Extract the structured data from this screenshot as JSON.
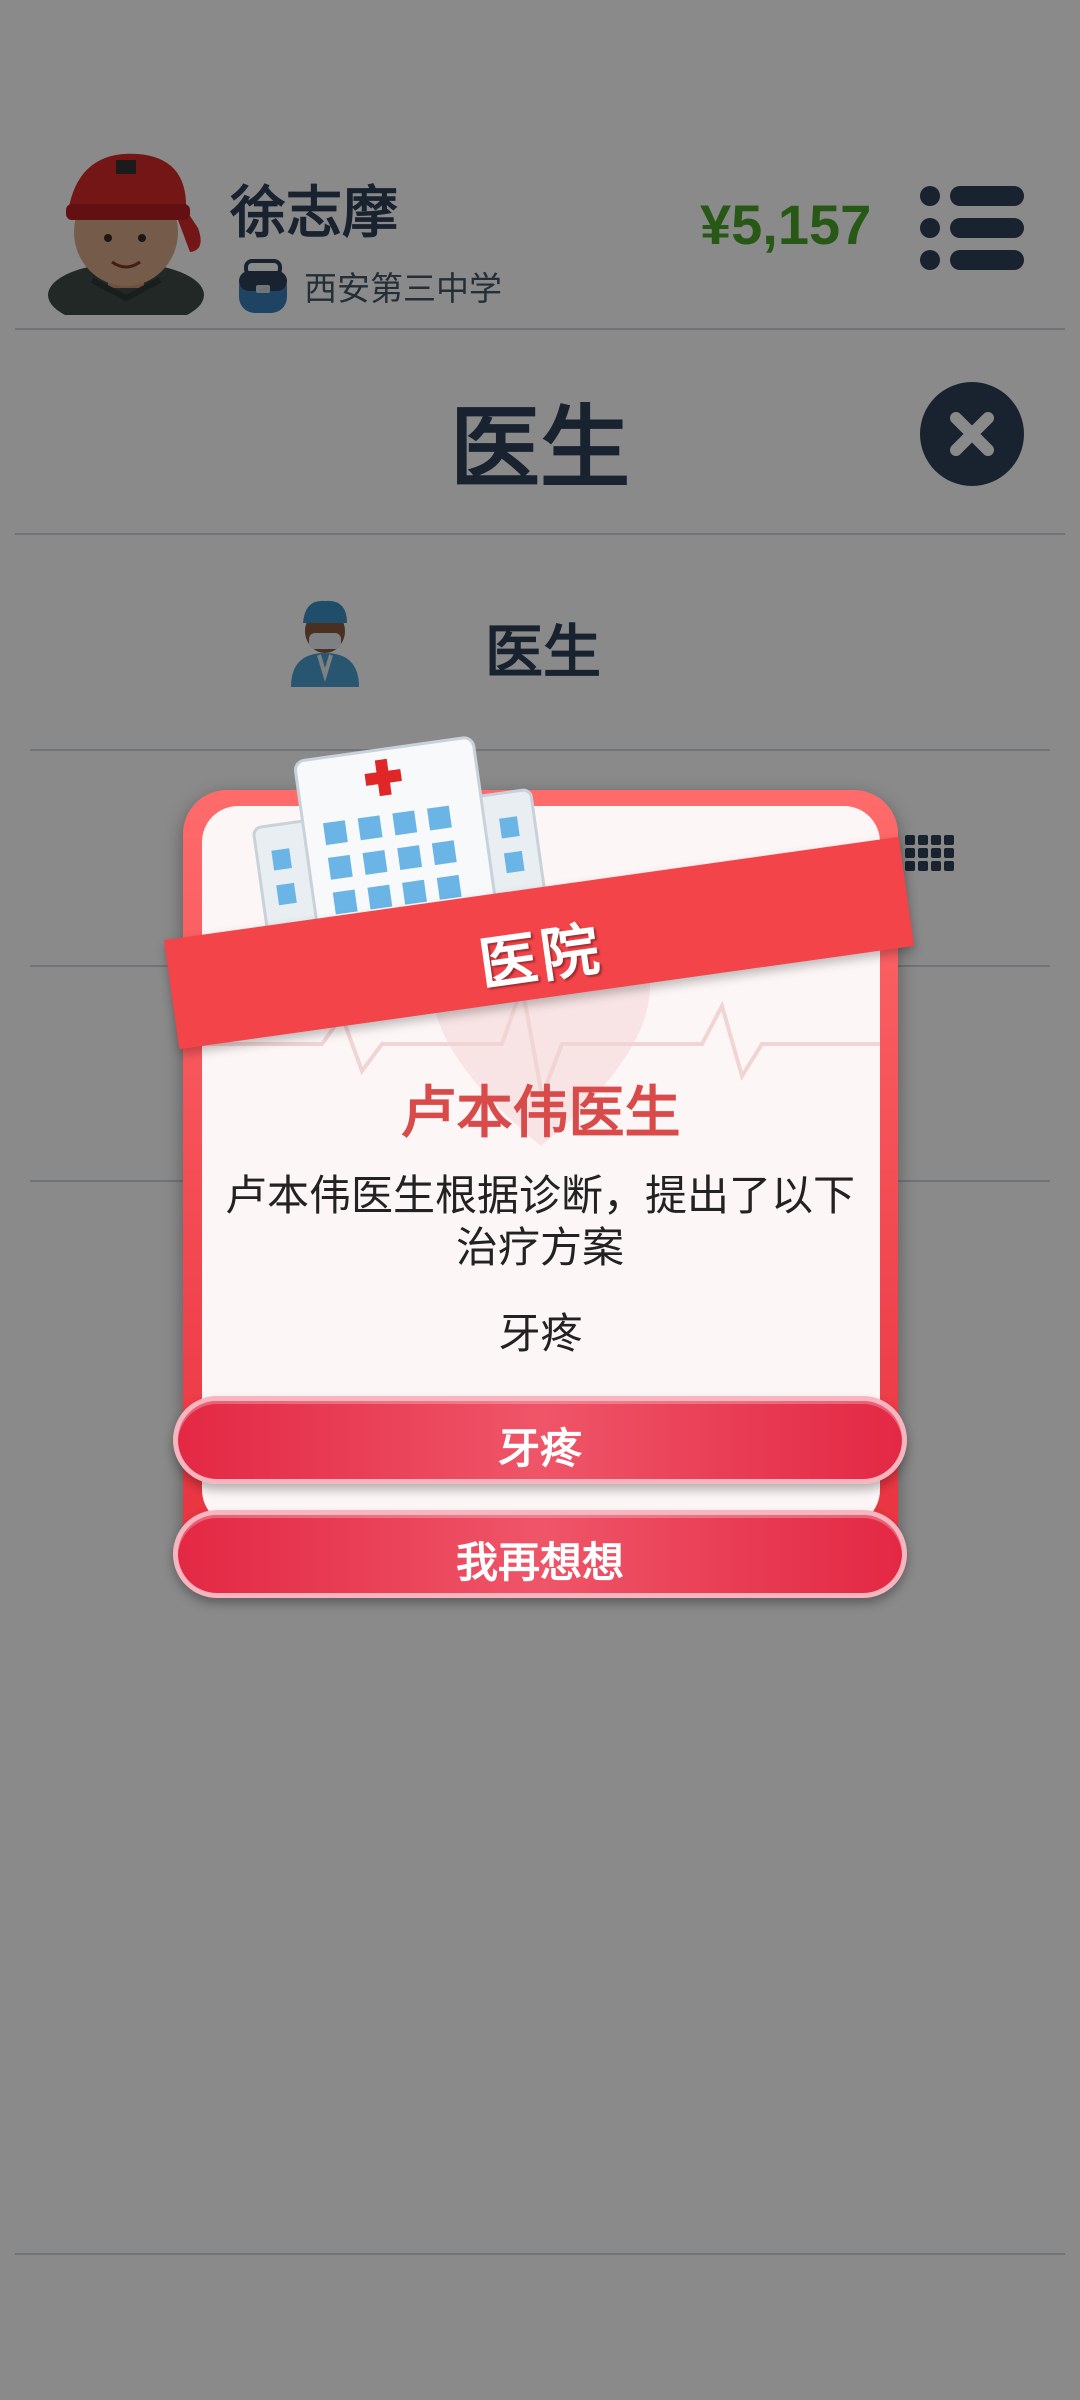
{
  "header": {
    "player_name": "徐志摩",
    "school": "西安第三中学",
    "money": "¥5,157"
  },
  "page": {
    "title": "医生",
    "rows": [
      {
        "label": "医生"
      }
    ]
  },
  "dialog": {
    "banner": "医院",
    "doctor_name": "卢本伟医生",
    "message": "卢本伟医生根据诊断，提出了以下治疗方案",
    "condition": "牙疼",
    "confirm_label": "牙疼",
    "cancel_label": "我再想想"
  },
  "colors": {
    "money": "#4aa32a",
    "accent": "#f24449",
    "header_text": "#2f3f58"
  },
  "icons": {
    "avatar": "boy-red-cap-avatar",
    "school": "school-bag-icon",
    "menu": "menu-icon",
    "close": "close-icon",
    "doctor": "doctor-icon",
    "grid": "grid-icon",
    "hospital": "hospital-building-icon"
  }
}
